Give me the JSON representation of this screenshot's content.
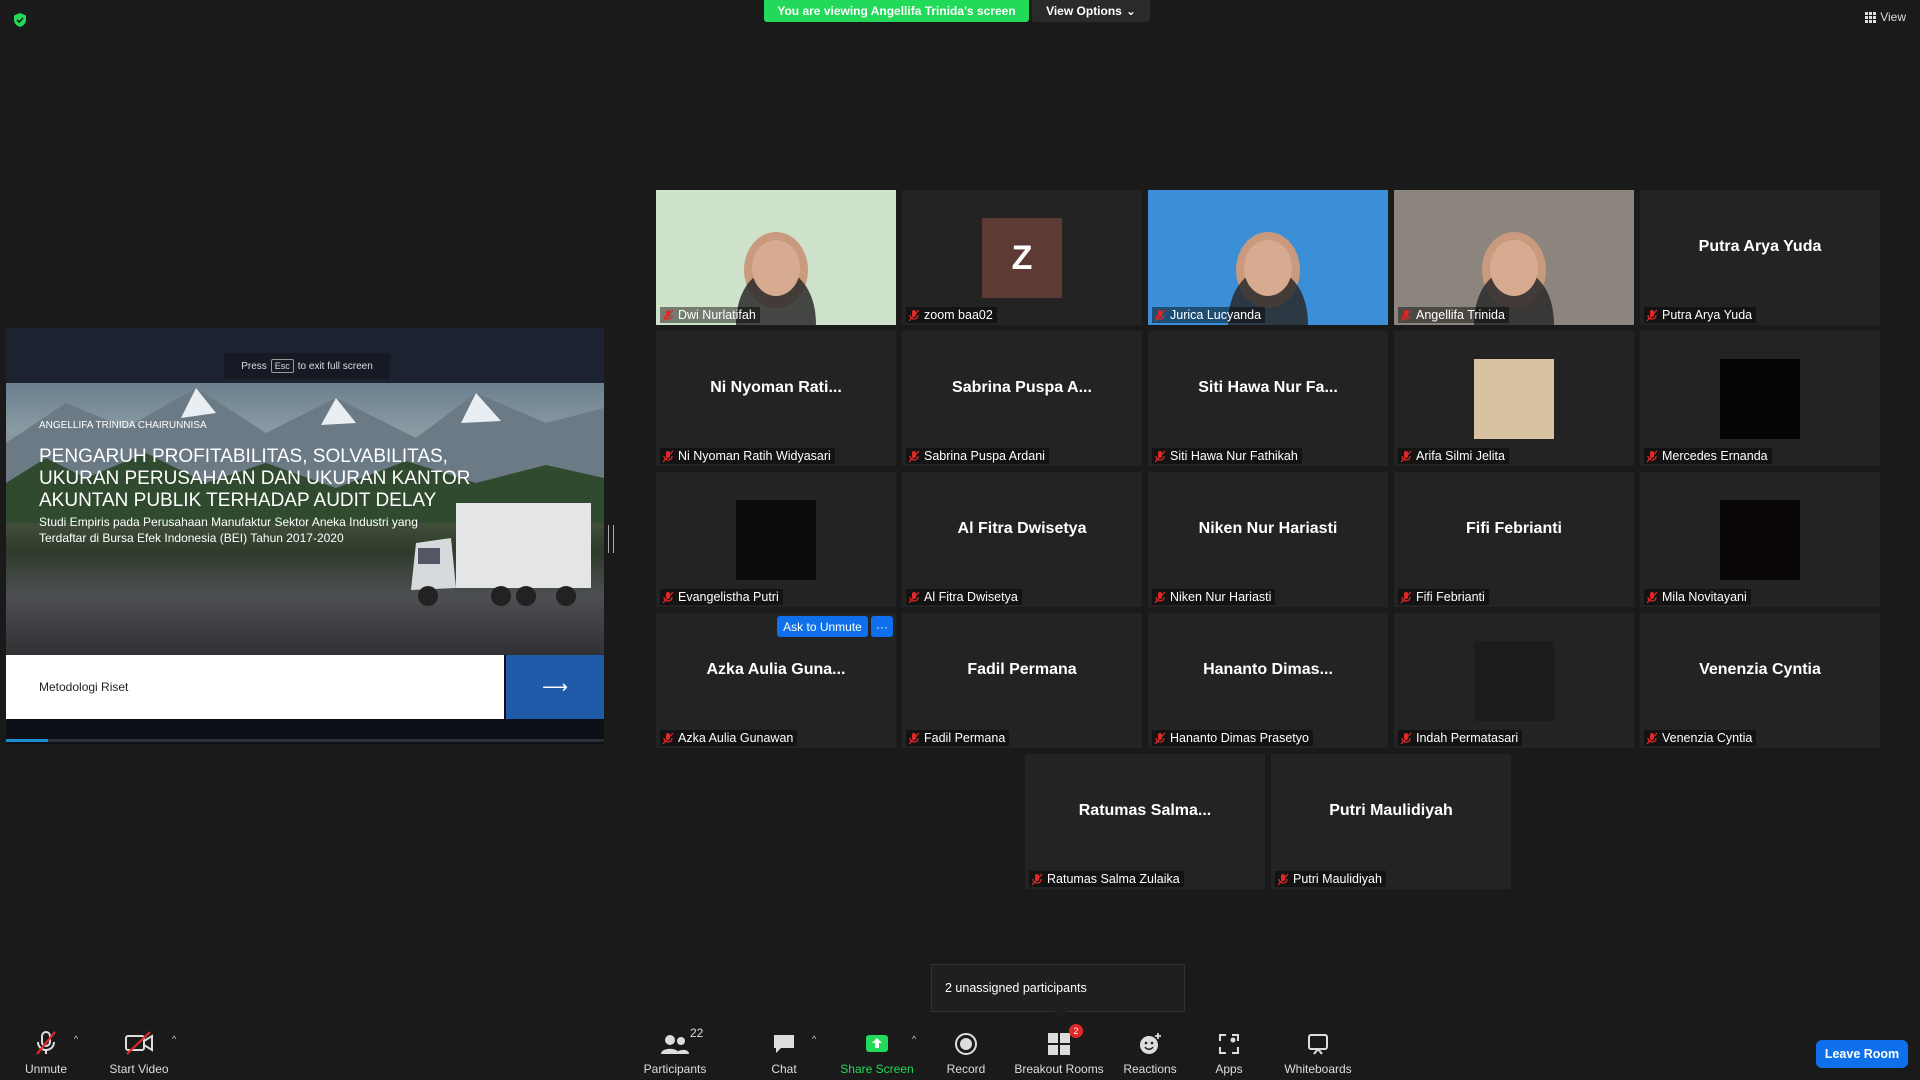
{
  "banner": {
    "text": "You are viewing Angellifa Trinida's screen",
    "view_options": "View Options"
  },
  "view_button": "View",
  "shared_slide": {
    "esc_hint_pre": "Press",
    "esc_key": "Esc",
    "esc_hint_post": "to exit full screen",
    "author": "ANGELLIFA TRINIDA CHAIRUNNISA",
    "title": "PENGARUH PROFITABILITAS, SOLVABILITAS, UKURAN PERUSAHAAN DAN UKURAN KANTOR AKUNTAN PUBLIK TERHADAP AUDIT DELAY",
    "subtitle": "Studi Empiris pada Perusahaan Manufaktur Sektor Aneka Industri yang Terdaftar di Bursa Efek Indonesia (BEI) Tahun 2017-2020",
    "nav_label": "Metodologi Riset",
    "nav_arrow": "⟶",
    "progress_fraction": 0.07
  },
  "tiles": [
    {
      "label": "Dwi Nurlatifah",
      "display": "video",
      "bg": "#cfe3cc"
    },
    {
      "label": "zoom baa02",
      "display": "avatar",
      "initial": "Z",
      "bg": "#5d3b34"
    },
    {
      "label": "Jurica Lucyanda",
      "display": "video",
      "bg": "#3a8fd6"
    },
    {
      "label": "Angellifa Trinida",
      "display": "video",
      "bg": "#8b857d",
      "active": true
    },
    {
      "label": "Putra Arya Yuda",
      "display": "name",
      "name": "Putra Arya Yuda"
    },
    {
      "label": "Ni Nyoman Ratih Widyasari",
      "display": "name",
      "name": "Ni Nyoman Rati..."
    },
    {
      "label": "Sabrina Puspa Ardani",
      "display": "name",
      "name": "Sabrina Puspa A..."
    },
    {
      "label": "Siti Hawa Nur Fathikah",
      "display": "name",
      "name": "Siti Hawa Nur Fa..."
    },
    {
      "label": "Arifa Silmi Jelita",
      "display": "photo",
      "bg": "#d9c2a0"
    },
    {
      "label": "Mercedes Ernanda",
      "display": "photo",
      "bg": "#050505"
    },
    {
      "label": "Evangelistha Putri",
      "display": "photo",
      "bg": "#0b0b0b"
    },
    {
      "label": "Al Fitra Dwisetya",
      "display": "name",
      "name": "Al Fitra Dwisetya"
    },
    {
      "label": "Niken Nur Hariasti",
      "display": "name",
      "name": "Niken Nur Hariasti"
    },
    {
      "label": "Fifi Febrianti",
      "display": "name",
      "name": "Fifi Febrianti"
    },
    {
      "label": "Mila Novitayani",
      "display": "photo",
      "bg": "#0a0607"
    },
    {
      "label": "Azka Aulia Gunawan",
      "display": "name",
      "name": "Azka Aulia Guna..."
    },
    {
      "label": "Fadil Permana",
      "display": "name",
      "name": "Fadil Permana"
    },
    {
      "label": "Hananto Dimas Prasetyo",
      "display": "name",
      "name": "Hananto Dimas..."
    },
    {
      "label": "Indah Permatasari",
      "display": "photo",
      "bg": "#1c1c1c"
    },
    {
      "label": "Venenzia Cyntia",
      "display": "name",
      "name": "Venenzia Cyntia"
    },
    {
      "label": "Ratumas Salma Zulaika",
      "display": "name",
      "name": "Ratumas Salma..."
    },
    {
      "label": "Putri Maulidiyah",
      "display": "name",
      "name": "Putri Maulidiyah"
    }
  ],
  "hover_controls": {
    "ask_unmute": "Ask to Unmute",
    "more": "···"
  },
  "unassigned": "2 unassigned participants",
  "toolbar": {
    "unmute": "Unmute",
    "start_video": "Start Video",
    "participants": "Participants",
    "participants_count": "22",
    "chat": "Chat",
    "share_screen": "Share Screen",
    "record": "Record",
    "breakout_rooms": "Breakout Rooms",
    "breakout_badge": "2",
    "reactions": "Reactions",
    "apps": "Apps",
    "whiteboards": "Whiteboards",
    "leave": "Leave Room"
  },
  "colors": {
    "share_green": "#23d959",
    "accent_blue": "#0e71eb",
    "active_speaker": "#e5e07a",
    "muted_red": "#e02828"
  }
}
